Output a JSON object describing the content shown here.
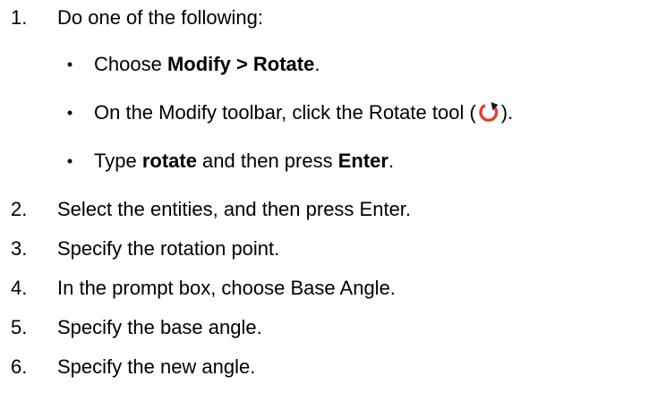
{
  "steps": [
    {
      "num": "1.",
      "text": "Do one of the following:"
    },
    {
      "num": "2.",
      "text": "Select the entities, and then press Enter."
    },
    {
      "num": "3.",
      "text": "Specify the rotation point."
    },
    {
      "num": "4.",
      "text": "In the prompt box, choose Base Angle."
    },
    {
      "num": "5.",
      "text": "Specify the base angle."
    },
    {
      "num": "6.",
      "text": "Specify the new angle."
    }
  ],
  "bullets": [
    {
      "prefix": "Choose ",
      "bold": "Modify > Rotate",
      "suffix": "."
    },
    {
      "prefix": "On the Modify toolbar, click the Rotate tool (",
      "icon": "rotate-icon",
      "suffix": ")."
    },
    {
      "prefix": "Type ",
      "bold1": "rotate",
      "middle": " and then press ",
      "bold2": "Enter",
      "suffix": "."
    }
  ],
  "bullet_glyph": "•",
  "icon_color": "#e53e2e"
}
